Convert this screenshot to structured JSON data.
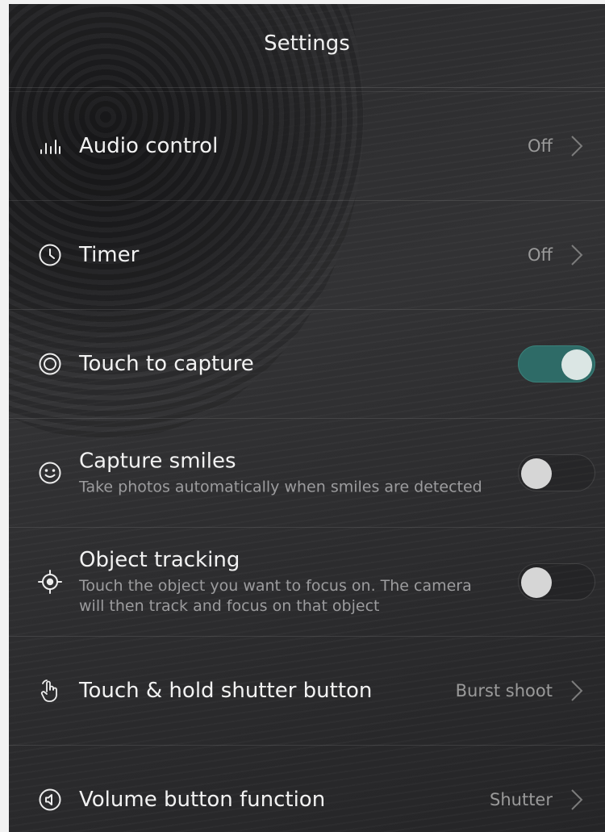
{
  "header": {
    "title": "Settings"
  },
  "colors": {
    "accent_on": "#2e6b67",
    "knob_on": "#dbe6e4",
    "knob_off": "#d6d6d6"
  },
  "rows": [
    {
      "icon": "audio-bars-icon",
      "title": "Audio control",
      "value": "Off",
      "control": "chevron"
    },
    {
      "icon": "clock-icon",
      "title": "Timer",
      "value": "Off",
      "control": "chevron"
    },
    {
      "icon": "touch-capture-icon",
      "title": "Touch to capture",
      "control": "toggle",
      "state": "on"
    },
    {
      "icon": "smile-icon",
      "title": "Capture smiles",
      "subtitle": "Take photos automatically when smiles are detected",
      "control": "toggle",
      "state": "off"
    },
    {
      "icon": "target-icon",
      "title": "Object tracking",
      "subtitle": "Touch the object you want to focus on. The camera will then track and focus on that object",
      "control": "toggle",
      "state": "off"
    },
    {
      "icon": "hand-pointer-icon",
      "title": "Touch & hold shutter button",
      "value": "Burst shoot",
      "control": "chevron"
    },
    {
      "icon": "volume-button-icon",
      "title": "Volume button function",
      "value": "Shutter",
      "control": "chevron"
    }
  ]
}
